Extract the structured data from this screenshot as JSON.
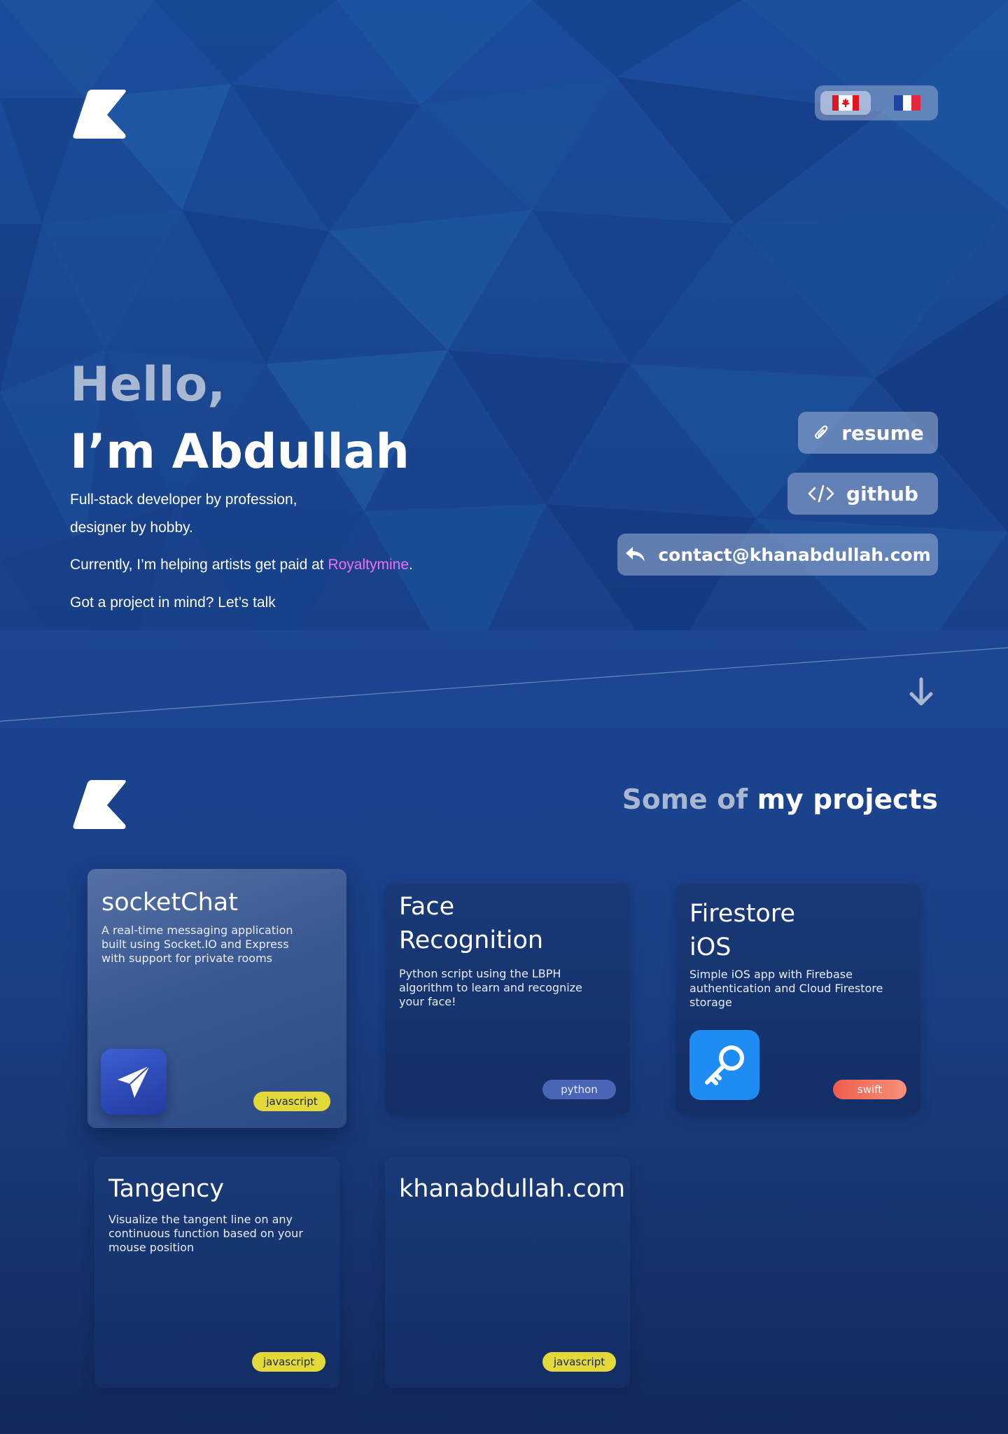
{
  "header": {
    "logo_icon": "k-logo-icon",
    "languages": [
      {
        "code": "en-CA",
        "icon": "canada-flag-icon",
        "active": true
      },
      {
        "code": "fr",
        "icon": "france-flag-icon",
        "active": false
      }
    ]
  },
  "hero": {
    "hello": "Hello,",
    "name": "I’m Abdullah",
    "bio_line1": "Full-stack developer by profession,",
    "bio_line2": "designer by hobby.",
    "current_prefix": "Currently, I’m  helping artists get paid at ",
    "current_link": "Royaltymine",
    "current_suffix": ".",
    "cta": "Got a project in mind? Let’s talk",
    "link_color": "#f36ef0"
  },
  "links": {
    "resume": {
      "label": "resume",
      "icon": "paperclip-icon"
    },
    "github": {
      "label": "github",
      "icon": "code-icon"
    },
    "contact": {
      "label": "contact@khanabdullah.com",
      "icon": "reply-icon"
    }
  },
  "scroll_icon": "arrow-down-icon",
  "projects": {
    "title_muted": "Some of ",
    "title_strong": "my projects",
    "items": [
      {
        "title": "socketChat",
        "desc": "A real-time messaging application built using Socket.IO and Express with support for private rooms",
        "tag": "javascript",
        "icon": "paper-plane-icon"
      },
      {
        "title": "Face Recognition",
        "desc": "Python script using the LBPH algorithm to learn and recognize your face!",
        "tag": "python"
      },
      {
        "title": "Firestore iOS",
        "desc": "Simple iOS app with Firebase authentication and Cloud Firestore storage",
        "tag": "swift",
        "icon": "key-icon"
      },
      {
        "title": "Tangency",
        "desc": "Visualize the tangent line on any continuous function based on your mouse position",
        "tag": "javascript"
      },
      {
        "title": "khanabdullah.com",
        "desc": "",
        "tag": "javascript"
      }
    ]
  },
  "colors": {
    "hero_bg": "#1a4792",
    "accent_pink": "#f36ef0",
    "tag_javascript": "#e3da3a",
    "tag_python": "#4a64b8",
    "tag_swift": "#ee5d4d"
  }
}
